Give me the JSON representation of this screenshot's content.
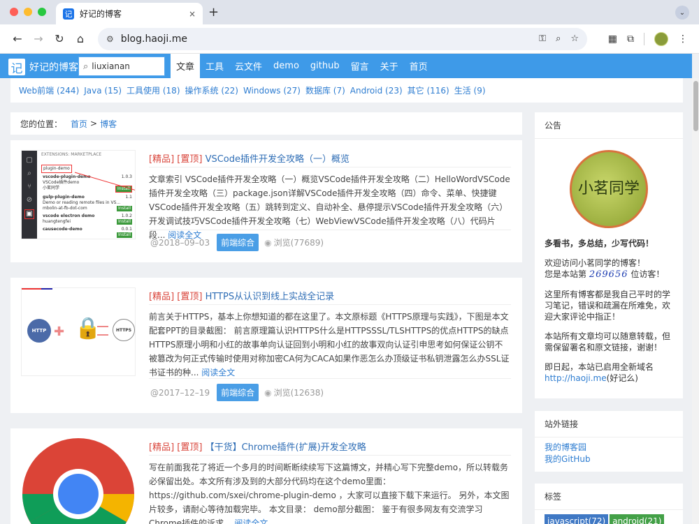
{
  "browser": {
    "tab_title": "好记的博客",
    "tab_favicon": "记",
    "tab_close": "×",
    "new_tab": "+",
    "url": "blog.haoji.me"
  },
  "site": {
    "logo_char": "记",
    "name": "好记的博客",
    "search_value": "liuxianan",
    "menu": [
      "文章",
      "工具",
      "云文件",
      "demo",
      "github",
      "留言",
      "关于",
      "首页"
    ]
  },
  "categories": [
    "Web前端 (244)",
    "Java (15)",
    "工具使用 (18)",
    "操作系统 (22)",
    "Windows (27)",
    "数据库 (7)",
    "Android (23)",
    "其它 (116)",
    "生活 (9)"
  ],
  "breadcrumb": {
    "label": "您的位置：",
    "home": "首页",
    "sep": ">",
    "current": "博客"
  },
  "posts": [
    {
      "tags": "[精品] [置顶]",
      "title": "VSCode插件开发全攻略（一）概览",
      "excerpt": "文章索引 VSCode插件开发全攻略（一）概览VSCode插件开发全攻略（二）HelloWordVSCode插件开发全攻略（三）package.json详解VSCode插件开发全攻略（四）命令、菜单、快捷键VSCode插件开发全攻略（五）跳转到定义、自动补全、悬停提示VSCode插件开发全攻略（六）开发调试技巧VSCode插件开发全攻略（七）WebViewVSCode插件开发全攻略（八）代码片段...",
      "readmore": "阅读全文",
      "date": "@2018–09–03",
      "category": "前端综合",
      "views": "浏览(77689)"
    },
    {
      "tags": "[精品] [置顶]",
      "title": "HTTPS从认识到线上实战全记录",
      "excerpt": "前言关于HTTPS，基本上你想知道的都在这里了。本文原标题《HTTPS原理与实践》，下图是本文配套PPT的目录截图： 前言原理篇认识HTTPS什么是HTTPSSSL/TLSHTTPS的优点HTTPS的缺点HTTPS原理小明和小红的故事单向认证回到小明和小红的故事双向认证引申思考如何保证公钥不被篡改为何正式传输时使用对称加密CA何为CACA如果作恶怎么办顶级证书私钥泄露怎么办SSL证书证书的种...",
      "readmore": "阅读全文",
      "date": "@2017–12–19",
      "category": "前端综合",
      "views": "浏览(12638)",
      "thumb_labels": [
        "HTTP",
        "HTTPS"
      ]
    },
    {
      "tags": "[精品] [置顶]",
      "title": "【干货】Chrome插件(扩展)开发全攻略",
      "excerpt": "写在前面我花了将近一个多月的时间断断续续写下这篇博文，并精心写下完整demo，所以转载务必保留出处。本文所有涉及到的大部分代码均在这个demo里面：https://github.com/sxei/chrome-plugin-demo ，大家可以直接下载下来运行。 另外，本文图片较多，请耐心等待加载完毕。 本文目录： demo部分截图： 鉴于有很多网友有交流学习Chrome插件的诉求...",
      "readmore": "阅读全文"
    }
  ],
  "thumb1": {
    "header": "EXTENSIONS: MARKETPLACE",
    "search": "plugin-demo",
    "items": [
      {
        "name": "vscode-plugin-demo",
        "ver": "1.0.3",
        "desc": "VSCode插件demo",
        "author": "小茗同学",
        "btn": "Install"
      },
      {
        "name": "gulp-plugin-demo",
        "ver": "1.1",
        "desc": "Demo or reading remote files in VS...",
        "author": "mbolin-at-fb-dot-com",
        "btn": "Install"
      },
      {
        "name": "vscode electron demo",
        "ver": "1.0.2",
        "desc": "",
        "author": "huangtengfei",
        "btn": "Install"
      },
      {
        "name": "causecode-demo",
        "ver": "0.0.1",
        "desc": "",
        "author": "",
        "btn": "Install"
      }
    ]
  },
  "sidebar": {
    "notice_title": "公告",
    "avatar_text": "小茗同学",
    "motto": "多看书，多总结，少写代码！",
    "welcome": "欢迎访问小茗同学的博客！",
    "visitor_prefix": "您是本站第",
    "visitor_count": "269656",
    "visitor_suffix": "位访客！",
    "intro": "这里所有博客都是我自己平时的学习笔记，错误和疏漏在所难免，欢迎大家评论中指正！",
    "copyright": "本站所有文章均可以随意转载，但需保留署名和原文链接，谢谢！",
    "domain_note": "即日起，本站已启用全新域名",
    "domain_url": "http://haoji.me",
    "domain_suffix": "(好记么)",
    "links_title": "站外链接",
    "links": [
      "我的博客园",
      "我的GitHub"
    ],
    "tags_title": "标签",
    "tags": [
      {
        "label": "javascript(72)",
        "color": "#3f78c4"
      },
      {
        "label": "android(21)",
        "color": "#43a047"
      }
    ]
  }
}
